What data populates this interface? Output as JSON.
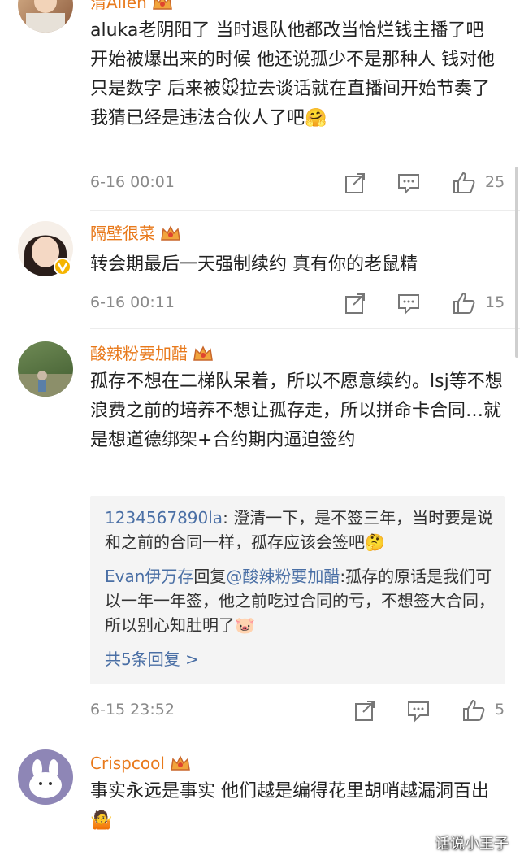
{
  "comments": [
    {
      "name": "渭Allen",
      "text": "aluka老阴阳了 当时退队他都改当恰烂钱主播了吧 开始被爆出来的时候 他还说孤少不是那种人 钱对他只是数字 后来被🐭拉去谈话就在直播间开始节奏了 我猜已经是违法合伙人了吧🤗",
      "time": "6-16 00:01",
      "likes": "25"
    },
    {
      "name": "隔壁很菜",
      "text": "转会期最后一天强制续约 真有你的老鼠精",
      "time": "6-16 00:11",
      "likes": "15"
    },
    {
      "name": "酸辣粉要加醋",
      "text": "孤存不想在二梯队呆着，所以不愿意续约。lsj等不想浪费之前的培养不想让孤存走，所以拼命卡合同…就是想道德绑架+合约期内逼迫签约",
      "replies": [
        {
          "user": "1234567890la",
          "text": ": 澄清一下，是不签三年，当时要是说和之前的合同一样，孤存应该会签吧🤔"
        },
        {
          "user": "Evan伊万存",
          "mid": "回复",
          "target": "@酸辣粉要加醋",
          "text": ":孤存的原话是我们可以一年一年签，他之前吃过合同的亏，不想签大合同，所以别心知肚明了🐷"
        }
      ],
      "more_replies": "共5条回复 >",
      "time": "6-15 23:52",
      "likes": "5"
    },
    {
      "name": "Crispcool",
      "text": "事实永远是事实 他们越是编得花里胡哨越漏洞百出🤷"
    }
  ],
  "watermark": "话说小王子",
  "colors": {
    "username": "#e8791b",
    "link": "#4a6fa5",
    "meta": "#8a8a8a"
  }
}
